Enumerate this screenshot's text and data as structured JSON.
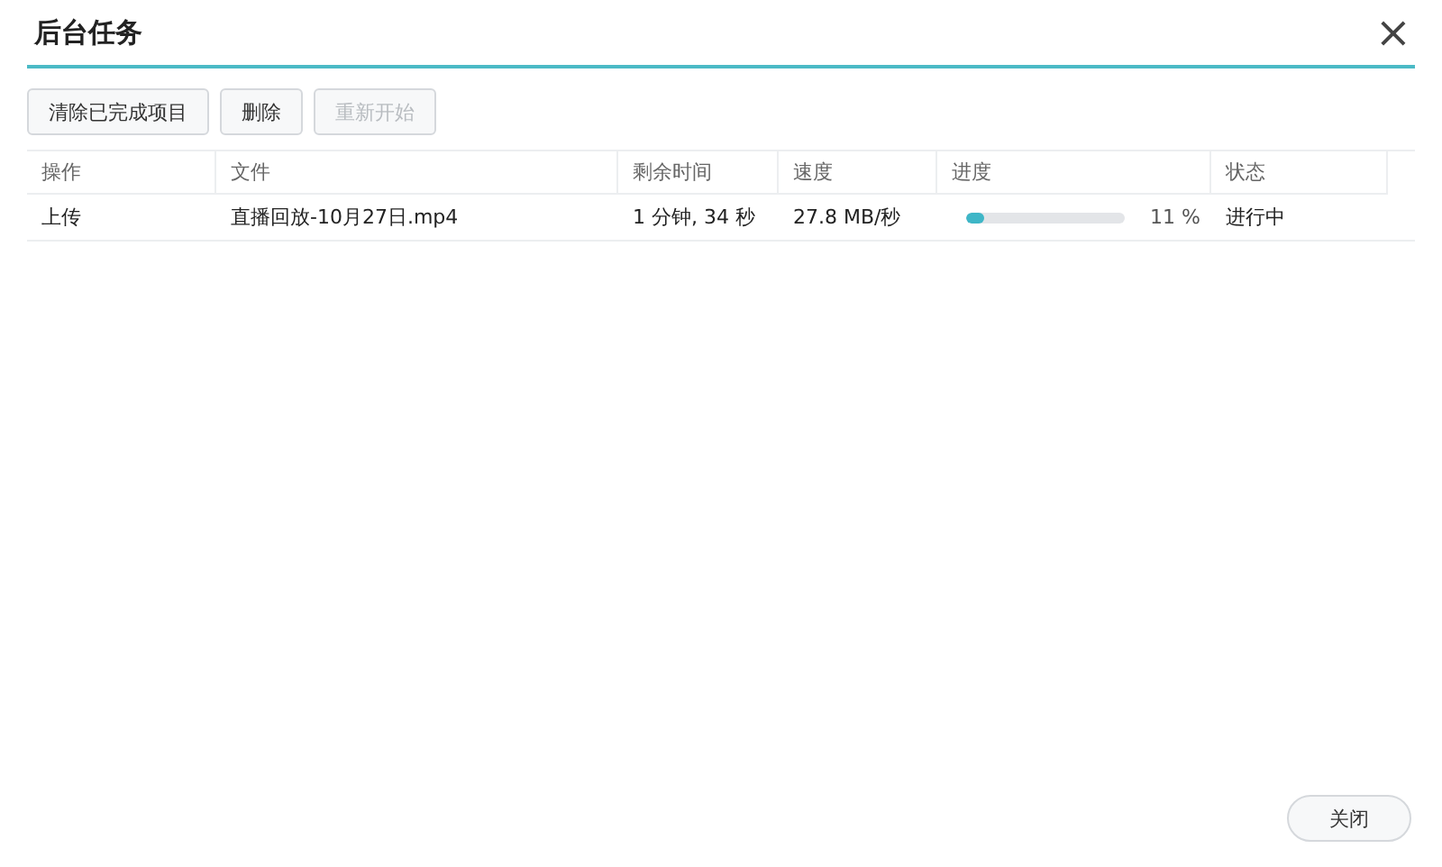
{
  "window": {
    "title": "后台任务",
    "close": "×"
  },
  "toolbar": [
    {
      "label": "清除已完成项目",
      "disabled": false
    },
    {
      "label": "删除",
      "disabled": false
    },
    {
      "label": "重新开始",
      "disabled": true
    }
  ],
  "table": {
    "columns": [
      "操作",
      "文件",
      "剩余时间",
      "速度",
      "进度",
      "状态"
    ],
    "rows": [
      {
        "action": "上传",
        "file": "直播回放-10月27日.mp4",
        "remaining": "1 分钟, 34 秒",
        "speed": "27.8 MB/秒",
        "level": 0.11,
        "percent": "11 %",
        "status": "进行中"
      }
    ]
  },
  "footer": {
    "close_button": "关闭"
  }
}
